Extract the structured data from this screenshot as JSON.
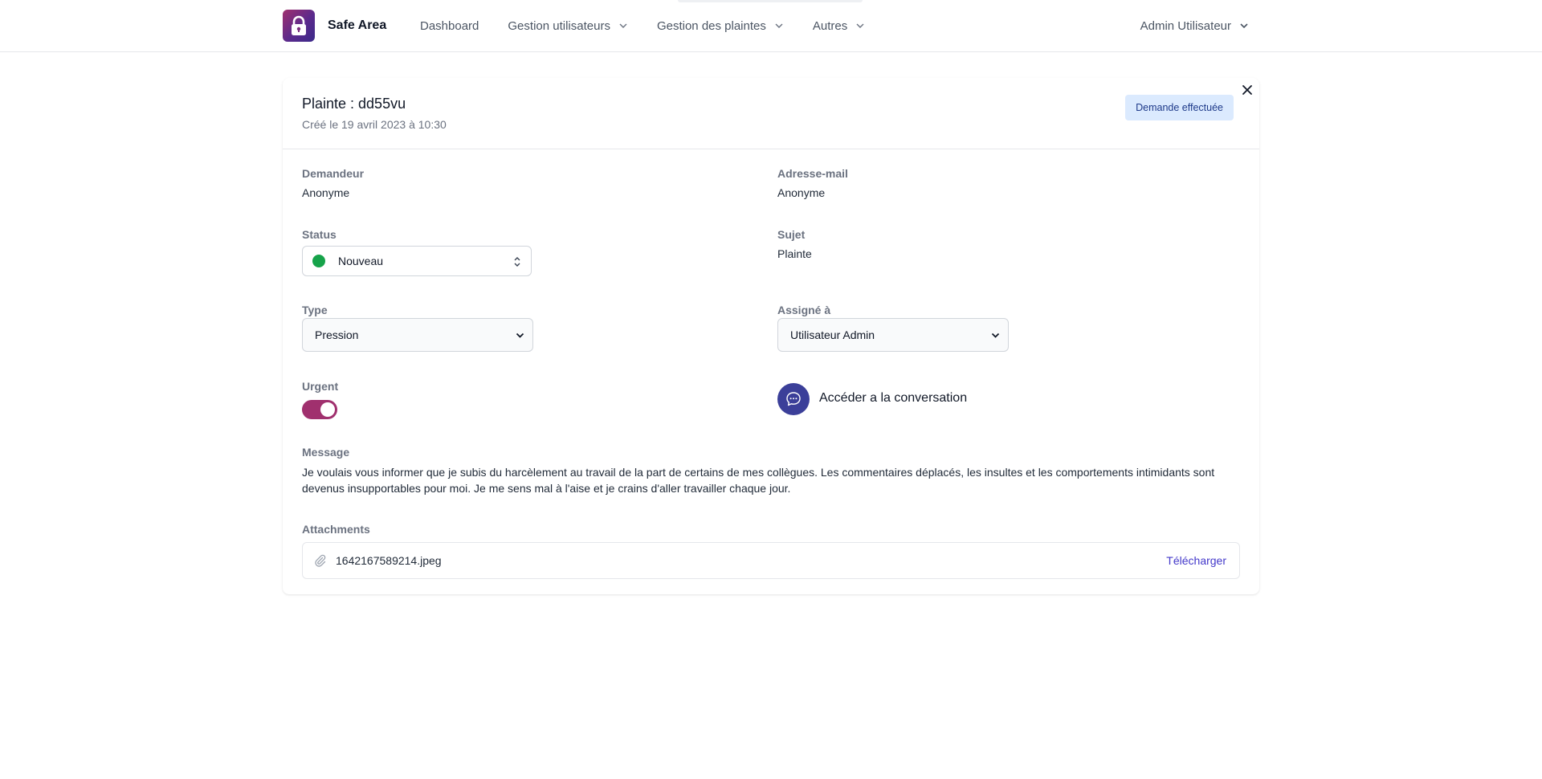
{
  "header": {
    "brand_name": "Safe Area",
    "nav": [
      {
        "label": "Dashboard"
      },
      {
        "label": "Gestion utilisateurs"
      },
      {
        "label": "Gestion des plaintes"
      },
      {
        "label": "Autres"
      }
    ],
    "user_menu_label": "Admin Utilisateur"
  },
  "complaint": {
    "title": "Plainte : dd55vu",
    "created": "Créé le 19 avril 2023 à 10:30",
    "badge": "Demande effectuée",
    "fields": {
      "requester_label": "Demandeur",
      "requester_value": "Anonyme",
      "email_label": "Adresse-mail",
      "email_value": "Anonyme",
      "status_label": "Status",
      "status_value": "Nouveau",
      "status_color": "#16a34a",
      "subject_label": "Sujet",
      "subject_value": "Plainte",
      "type_label": "Type",
      "type_value": "Pression",
      "assigned_label": "Assigné à",
      "assigned_value": "Utilisateur Admin",
      "urgent_label": "Urgent",
      "urgent_on": true,
      "conversation_label": "Accéder a la conversation"
    },
    "message_label": "Message",
    "message": "Je voulais vous informer que je subis du harcèlement au travail de la part de certains de mes collègues. Les commentaires déplacés, les insultes et les comportements intimidants sont devenus insupportables pour moi. Je me sens mal à l'aise et je crains d'aller travailler chaque jour.",
    "attachments_label": "Attachments",
    "attachments": [
      {
        "file_name": "1642167589214.jpeg",
        "action": "Télécharger"
      }
    ]
  },
  "colors": {
    "accent": "#a0306e",
    "badge_bg": "#dbeafe",
    "convo_button": "#3b3f99",
    "link": "#4338ca"
  }
}
